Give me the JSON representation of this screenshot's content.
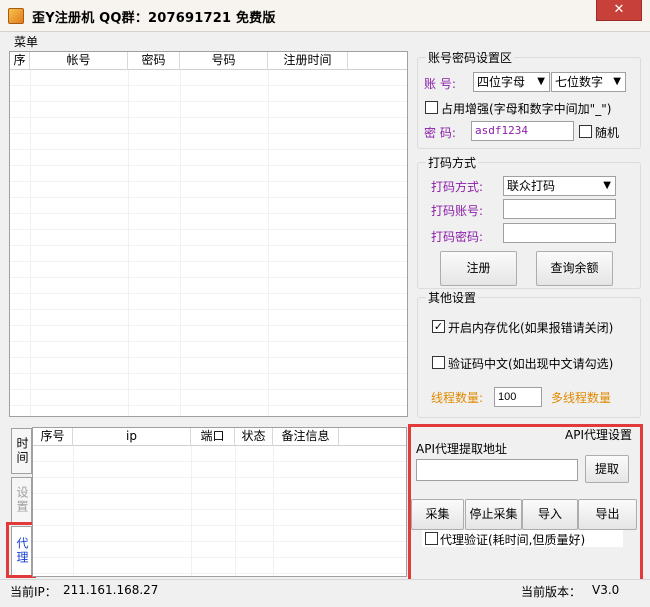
{
  "window": {
    "title": "歪Y注册机   QQ群：207691721   免费版",
    "close_symbol": "✕"
  },
  "menu": {
    "items": [
      "菜单"
    ]
  },
  "account_table": {
    "columns": [
      "序",
      "帐号",
      "密码",
      "号码",
      "注册时间"
    ]
  },
  "account_settings": {
    "group_title": "账号密码设置区",
    "account_label": "账   号:",
    "account_type": "四位字母",
    "account_digits": "七位数字",
    "enhance_label": "占用增强(字母和数字中间加\"_\")",
    "enhance_checked": false,
    "password_label": "密   码:",
    "password_value": "asdf1234",
    "random_label": "随机",
    "random_checked": false
  },
  "captcha": {
    "group_title": "打码方式",
    "method_label": "打码方式:",
    "method_value": "联众打码",
    "account_label": "打码账号:",
    "account_value": "",
    "password_label": "打码密码:",
    "password_value": "",
    "register_button": "注册",
    "balance_button": "查询余额"
  },
  "other": {
    "group_title": "其他设置",
    "mem_opt_label": "开启内存优化(如果报错请关闭)",
    "mem_opt_checked": true,
    "captcha_cn_label": "验证码中文(如出现中文请勾选)",
    "captcha_cn_checked": false,
    "threads_label": "线程数量:",
    "threads_value": "100",
    "multithread_label": "多线程数量"
  },
  "side_tabs": [
    "时间",
    "设置",
    "代理"
  ],
  "proxy_table": {
    "columns": [
      "序号",
      "ip",
      "端口",
      "状态",
      "备注信息"
    ]
  },
  "proxy_settings": {
    "group_title": "API代理设置",
    "api_label": "API代理提取地址",
    "api_value": "",
    "fetch_button": "提取",
    "collect_button": "采集",
    "stop_button": "停止采集",
    "import_button": "导入",
    "export_button": "导出",
    "verify_label": "代理验证(耗时间,但质量好)",
    "verify_checked": false
  },
  "status": {
    "ip_label": "当前IP：",
    "ip_value": "211.161.168.27",
    "version_label": "当前版本：",
    "version_value": "V3.0"
  }
}
